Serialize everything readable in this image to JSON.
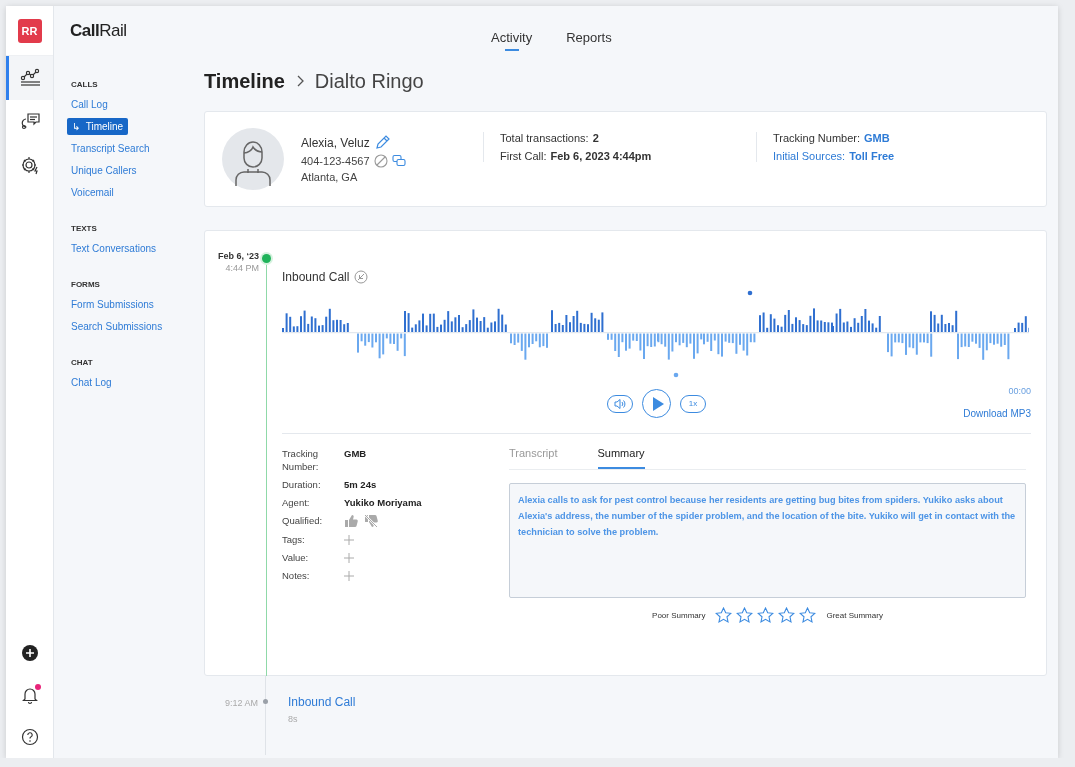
{
  "rail": {
    "initials": "RR",
    "items": [
      {
        "kind": "analytics",
        "selected": true
      },
      {
        "kind": "conversations",
        "selected": false
      },
      {
        "kind": "settings",
        "selected": false
      }
    ],
    "bottom": [
      {
        "kind": "add",
        "unread": false
      },
      {
        "kind": "notifications",
        "unread": true
      },
      {
        "kind": "help",
        "unread": false
      }
    ]
  },
  "logo": "**Call**Rail",
  "top_tabs": [
    {
      "label": "Activity",
      "selected": true
    },
    {
      "label": "Reports",
      "selected": false
    }
  ],
  "nav": [
    {
      "heading": "CALLS",
      "items": [
        {
          "label": "Call Log",
          "selected": false
        },
        {
          "label": "Timeline",
          "selected": true,
          "prefix": "↳"
        },
        {
          "label": "Transcript Search",
          "selected": false
        },
        {
          "label": "Unique Callers",
          "selected": false
        },
        {
          "label": "Voicemail",
          "selected": false
        }
      ]
    },
    {
      "heading": "TEXTS",
      "items": [
        {
          "label": "Text Conversations",
          "selected": false
        }
      ]
    },
    {
      "heading": "FORMS",
      "items": [
        {
          "label": "Form Submissions",
          "selected": false
        },
        {
          "label": "Search Submissions",
          "selected": false
        }
      ]
    },
    {
      "heading": "CHAT",
      "items": [
        {
          "label": "Chat Log",
          "selected": false
        }
      ]
    }
  ],
  "breadcrumb": {
    "title": "Timeline",
    "current": "Dialto Ringo"
  },
  "contact": {
    "name": "Alexia, Veluz",
    "phone": "404-123-4567",
    "location": "Atlanta, GA",
    "stats": [
      {
        "label": "Total transactions:",
        "value": "2"
      },
      {
        "label": "First Call:",
        "value": "Feb 6, 2023 4:44pm"
      }
    ],
    "sources": [
      {
        "label": "Tracking Number:",
        "value": "GMB",
        "kind": "plain"
      },
      {
        "label": "Initial Sources:",
        "value": "Toll Free",
        "kind": "link"
      }
    ]
  },
  "call": {
    "date": "Feb 6, ‘23",
    "time": "4:44 PM",
    "title": "Inbound Call",
    "player": {
      "time": "00:00",
      "speed": "1x",
      "download": "Download MP3"
    },
    "details": [
      {
        "label": "Tracking Number:",
        "value": "GMB",
        "kind": "text"
      },
      {
        "label": "Duration:",
        "value": "5m 24s",
        "kind": "text"
      },
      {
        "label": "Agent:",
        "value": "Yukiko Moriyama",
        "kind": "text"
      },
      {
        "label": "Qualified:",
        "kind": "thumbs"
      },
      {
        "label": "Tags:",
        "kind": "add"
      },
      {
        "label": "Value:",
        "kind": "add"
      },
      {
        "label": "Notes:",
        "kind": "add"
      }
    ],
    "tabs": [
      {
        "label": "Transcript",
        "selected": false
      },
      {
        "label": "Summary",
        "selected": true
      }
    ],
    "summary": "Alexia calls to ask for pest control because her residents are getting bug bites from spiders. Yukiko asks about Alexia's address, the number of the spider problem, and the location of the bite. Yukiko will get in contact with the technician to solve the problem.",
    "rating": {
      "low": "Poor Summary",
      "high": "Great Summary",
      "stars": 0
    }
  },
  "events": [
    {
      "time": "9:12 AM",
      "title": "Inbound Call",
      "duration": "8s"
    }
  ]
}
